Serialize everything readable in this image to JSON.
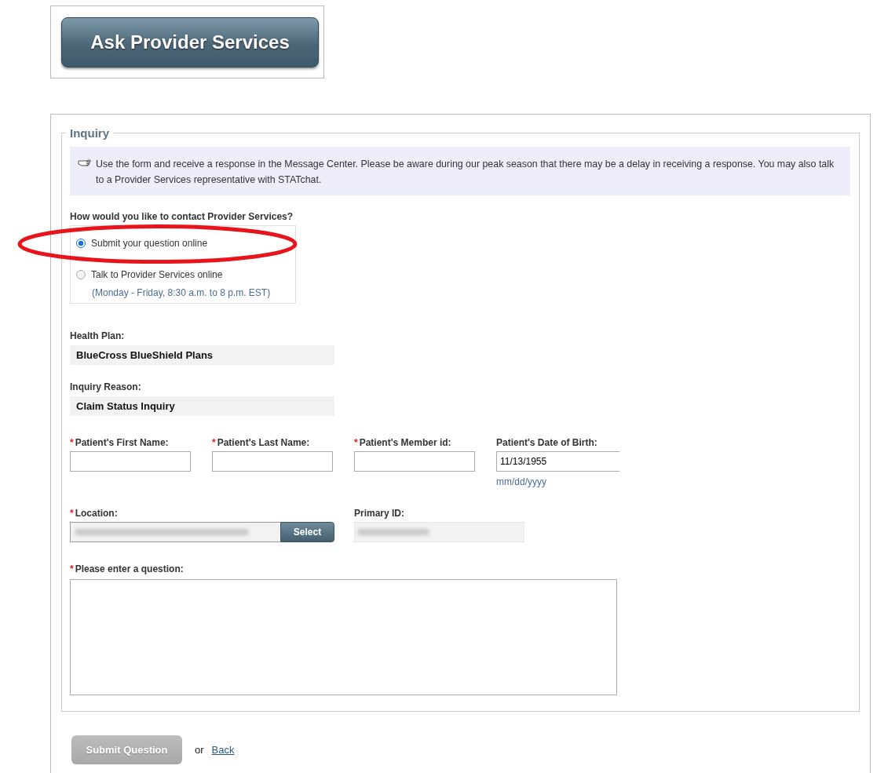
{
  "header_button": "Ask Provider Services",
  "inquiry": {
    "legend": "Inquiry",
    "notice": "Use the form and receive a response in the Message Center. Please be aware during our peak season that there may be a delay in receiving a response. You may also talk to a Provider Services representative with STATchat.",
    "contact_question": "How would you like to contact Provider Services?",
    "contact_options": [
      {
        "label": "Submit your question online",
        "selected": true
      },
      {
        "label": "Talk to Provider Services online",
        "note": "(Monday - Friday, 8:30 a.m. to 8 p.m. EST)",
        "selected": false
      }
    ],
    "health_plan": {
      "label": "Health Plan:",
      "value": "BlueCross BlueShield Plans"
    },
    "inquiry_reason": {
      "label": "Inquiry Reason:",
      "value": "Claim Status Inquiry"
    },
    "patient_fields": [
      {
        "marker": "*",
        "label": "Patient's First Name:"
      },
      {
        "marker": "*",
        "label": "Patient's Last Name:"
      },
      {
        "marker": "*",
        "label": "Patient's Member id:"
      },
      {
        "label": "Patient's Date of Birth:",
        "value": "11/13/1955",
        "hint": "mm/dd/yyyy"
      }
    ],
    "location": {
      "marker": "*",
      "label": "Location:",
      "button": "Select"
    },
    "primary_id": {
      "label": "Primary ID:"
    },
    "question": {
      "marker": "*",
      "label": "Please enter a question:"
    }
  },
  "actions": {
    "submit": {
      "label": "Submit Question",
      "disabled": true
    },
    "separator": "or",
    "back": "Back"
  }
}
